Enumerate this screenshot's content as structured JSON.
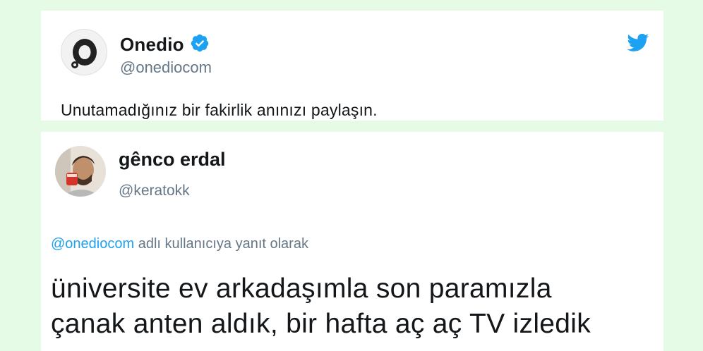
{
  "source_tweet": {
    "author_name": "Onedio",
    "author_handle": "@onediocom",
    "text": "Unutamadığınız bir fakirlik anınızı paylaşın.",
    "icons": {
      "avatar": "onedio-logo-avatar",
      "verified": "verified-badge-icon",
      "platform": "twitter-bird-icon"
    },
    "colors": {
      "verified": "#1da1f2",
      "bird": "#1da1f2"
    }
  },
  "reply_tweet": {
    "author_name": "gênco erdal",
    "author_handle": "@keratokk",
    "reply_mention": "@onediocom",
    "reply_suffix": "adlı kullanıcıya yanıt olarak",
    "text_line_1": "üniversite ev arkadaşımla son paramızla",
    "text_line_2": "çanak anten aldık, bir hafta aç aç TV izledik",
    "icons": {
      "avatar": "user-photo-avatar"
    },
    "colors": {
      "mention": "#1da1f2"
    }
  },
  "colors": {
    "background": "#e6fbe6",
    "text_primary": "#14171a",
    "text_secondary": "#657786"
  }
}
